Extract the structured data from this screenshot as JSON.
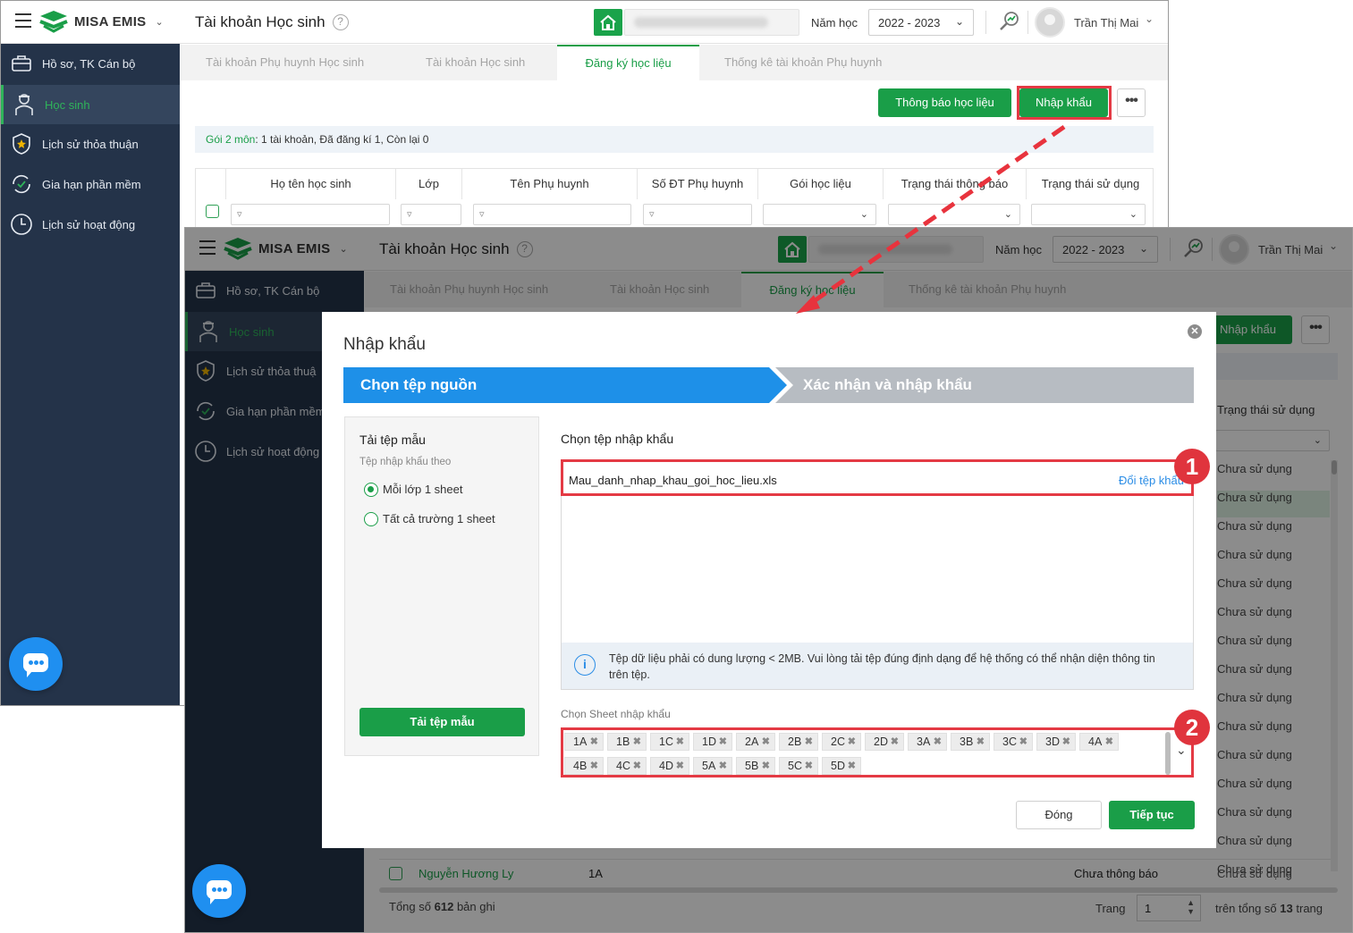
{
  "back": {
    "app_name": "MISA EMIS",
    "page_title": "Tài khoản Học sinh",
    "year_label": "Năm học",
    "year_value": "2022 - 2023",
    "user_name": "Trần Thị Mai",
    "sidebar": [
      {
        "label": "Hồ sơ, TK Cán bộ",
        "icon": "briefcase-icon"
      },
      {
        "label": "Học sinh",
        "icon": "student-icon"
      },
      {
        "label": "Lịch sử thỏa thuận",
        "icon": "shield-star-icon"
      },
      {
        "label": "Gia hạn phần mềm",
        "icon": "refresh-check-icon"
      },
      {
        "label": "Lịch sử hoạt động",
        "icon": "clock-icon"
      }
    ],
    "tabs": [
      "Tài khoản Phụ huynh Học sinh",
      "Tài khoản Học sinh",
      "Đăng ký học liệu",
      "Thống kê tài khoản Phụ huynh"
    ],
    "btn_notify": "Thông báo học liệu",
    "btn_import": "Nhập khẩu",
    "info_green": "Gói 2 môn",
    "info_rest": ": 1 tài khoản, Đã đăng kí 1, Còn lại 0",
    "columns": [
      "Họ tên học sinh",
      "Lớp",
      "Tên Phụ huynh",
      "Số ĐT Phụ huynh",
      "Gói học liệu",
      "Trạng thái thông báo",
      "Trạng thái sử dụng"
    ]
  },
  "front": {
    "app_name": "MISA EMIS",
    "page_title": "Tài khoản Học sinh",
    "year_label": "Năm học",
    "year_value": "2022 - 2023",
    "user_name": "Trần Thị Mai",
    "sidebar": [
      {
        "label": "Hồ sơ, TK Cán bộ"
      },
      {
        "label": "Học sinh"
      },
      {
        "label": "Lịch sử thỏa thuậ"
      },
      {
        "label": "Gia hạn phần mềm"
      },
      {
        "label": "Lịch sử hoạt động"
      }
    ],
    "tabs": [
      "Tài khoản Phụ huynh Học sinh",
      "Tài khoản Học sinh",
      "Đăng ký học liệu",
      "Thống kê tài khoản Phụ huynh"
    ],
    "btn_import": "Nhập khẩu",
    "col_status": "Trạng thái sử dụng",
    "status_rows": [
      "Chưa sử dụng",
      "Chưa sử dụng",
      "Chưa sử dụng",
      "Chưa sử dụng",
      "Chưa sử dụng",
      "Chưa sử dụng",
      "Chưa sử dụng",
      "Chưa sử dụng",
      "Chưa sử dụng",
      "Chưa sử dụng",
      "Chưa sử dụng",
      "Chưa sử dụng",
      "Chưa sử dụng",
      "Chưa sử dụng",
      "Chưa sử dụng"
    ],
    "last_row": {
      "name": "Nguyễn Hương Ly",
      "class": "1A",
      "notify": "Chưa thông báo",
      "status": "Chưa sử dụng"
    },
    "footer": {
      "total_prefix": "Tổng số",
      "total": "612",
      "total_suffix": "bản ghi",
      "page_label": "Trang",
      "page_value": "1",
      "of_prefix": "trên tổng số",
      "pages": "13",
      "of_suffix": "trang"
    }
  },
  "modal": {
    "title": "Nhập khẩu",
    "step1": "Chọn tệp nguồn",
    "step2": "Xác nhận và nhập khẩu",
    "left_title": "Tải tệp mẫu",
    "left_sub": "Tệp nhập khẩu theo",
    "radio1": "Mỗi lớp 1 sheet",
    "radio2": "Tất cả trường 1 sheet",
    "btn_download": "Tải tệp mẫu",
    "file_title": "Chọn tệp nhập khẩu",
    "file_name": "Mau_danh_nhap_khau_goi_hoc_lieu.xls",
    "change_file": "Đổi tệp khẩu",
    "note": "Tệp dữ liệu phải có dung lượng < 2MB. Vui lòng tải tệp đúng định dạng để hệ thống có thể nhận diện thông tin trên tệp.",
    "sheet_label": "Chọn Sheet nhập khẩu",
    "sheets_row1": [
      "1A",
      "1B",
      "1C",
      "1D",
      "2A",
      "2B",
      "2C",
      "2D",
      "3A",
      "3B",
      "3C",
      "3D",
      "4A"
    ],
    "sheets_row2": [
      "4B",
      "4C",
      "4D",
      "5A",
      "5B",
      "5C",
      "5D"
    ],
    "btn_close": "Đóng",
    "btn_next": "Tiếp tục"
  },
  "annotations": {
    "badge1": "1",
    "badge2": "2"
  },
  "colors": {
    "green": "#1a9e48",
    "sidebar": "#243349",
    "step_active": "#1e90e8",
    "step_inactive": "#b7bcc2",
    "highlight": "#e43a44"
  }
}
